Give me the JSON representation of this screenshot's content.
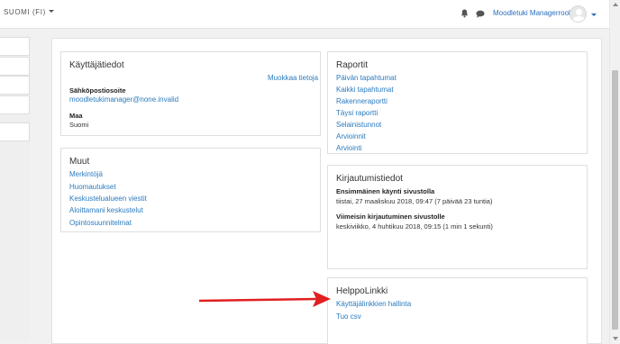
{
  "navbar": {
    "language": "SUOMI (FI)",
    "bell_icon": "bell-icon",
    "chat_icon": "chat-icon",
    "user_name": "Moodletuki Managerrooli"
  },
  "colors": {
    "link": "#2a7bbf",
    "arrow": "#e02020",
    "background": "#f1f1f1"
  },
  "user_details": {
    "title": "Käyttäjätiedot",
    "edit_link": "Muokkaa tietoja",
    "email_label": "Sähköpostiosoite",
    "email_value": "moodletukimanager@none.invalid",
    "country_label": "Maa",
    "country_value": "Suomi"
  },
  "misc": {
    "title": "Muut",
    "links": [
      "Merkintöjä",
      "Huomautukset",
      "Keskustelualueen viestit",
      "Aloittamani keskustelut",
      "Opintosuunnitelmat"
    ]
  },
  "reports": {
    "title": "Raportit",
    "links": [
      "Päivän tapahtumat",
      "Kaikki tapahtumat",
      "Rakenneraportti",
      "Täysi raportti",
      "Selainistunnot",
      "Arvioinnit",
      "Arviointi"
    ]
  },
  "login_activity": {
    "title": "Kirjautumistiedot",
    "first_access_label": "Ensimmäinen käynti sivustolla",
    "first_access_value": "tiistai, 27 maaliskuu 2018, 09:47  (7 päivää 23 tuntia)",
    "last_access_label": "Viimeisin kirjautuminen sivustolle",
    "last_access_value": "keskiviikko, 4 huhtikuu 2018, 09:15  (1 min 1 sekunti)"
  },
  "easylink": {
    "title": "HelppoLinkki",
    "links": [
      "Käyttäjälinkkien hallinta",
      "Tuo csv"
    ]
  }
}
